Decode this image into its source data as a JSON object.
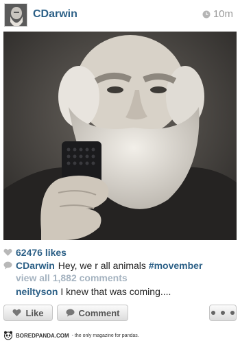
{
  "header": {
    "username": "CDarwin",
    "timestamp": "10m"
  },
  "stats": {
    "likes": "62476 likes"
  },
  "caption": {
    "user": "CDarwin",
    "text": "Hey, we r all animals",
    "hashtag": "#movember"
  },
  "comments": {
    "view_all": "view all 1,882 comments",
    "items": [
      {
        "user": "neiltyson",
        "text": "I knew that was coming...."
      }
    ]
  },
  "actions": {
    "like_label": "Like",
    "comment_label": "Comment"
  },
  "footer": {
    "brand": "BOREDPANDA.COM",
    "tagline": "- the only magazine for pandas."
  },
  "colors": {
    "link": "#2b5f86",
    "muted": "#9a9a9a",
    "view_all": "#a5b3c0"
  }
}
